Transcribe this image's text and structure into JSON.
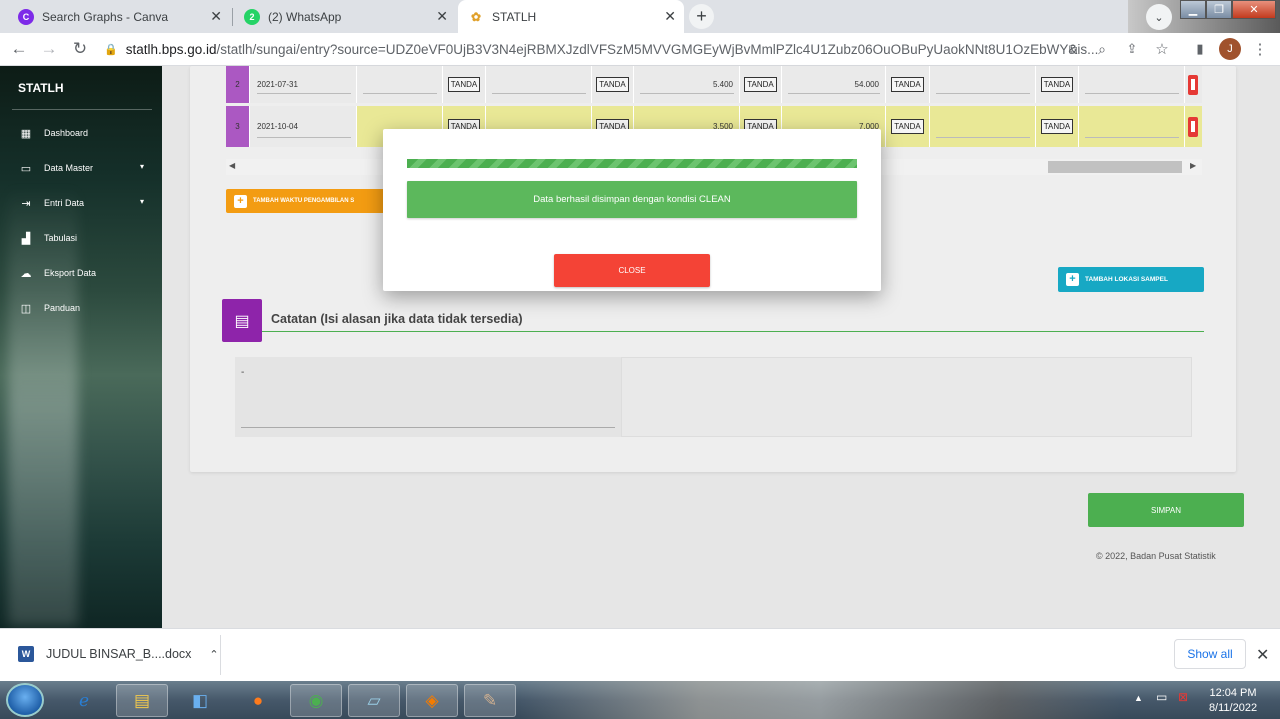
{
  "browser": {
    "tabs": [
      {
        "label": "Search Graphs - Canva",
        "icon": "canva-icon",
        "color": "#7d2ae8"
      },
      {
        "label": "(2) WhatsApp",
        "icon": "whatsapp-icon",
        "badge": "2",
        "color": "#25d366"
      },
      {
        "label": "STATLH",
        "icon": "statlh-icon",
        "active": true
      }
    ],
    "url_domain": "statlh.bps.go.id",
    "url_path": "/statlh/sungai/entry?source=UDZ0eVF0UjB3V3N4ejRBMXJzdlVFSzM5MVVGMGEyWjBvMmlPZlc4U1Zubz06OuOBuPyUaokNNt8U1OzEbWY&is...",
    "profile_initial": "J"
  },
  "sidebar": {
    "brand": "STATLH",
    "items": [
      {
        "label": "Dashboard",
        "icon": "dashboard-icon"
      },
      {
        "label": "Data Master",
        "icon": "folder-icon",
        "caret": true
      },
      {
        "label": "Entri Data",
        "icon": "login-icon",
        "caret": true
      },
      {
        "label": "Tabulasi",
        "icon": "bar-chart-icon"
      },
      {
        "label": "Eksport Data",
        "icon": "cloud-download-icon"
      },
      {
        "label": "Panduan",
        "icon": "book-icon"
      }
    ]
  },
  "table": {
    "rows": [
      {
        "no": "2",
        "date": "2021-07-31",
        "tanda": "TANDA",
        "v1": "5.400",
        "v2": "54.000",
        "highlight": false
      },
      {
        "no": "3",
        "date": "2021-10-04",
        "tanda": "TANDA",
        "v1": "3.500",
        "v2": "7.000",
        "highlight": true
      }
    ]
  },
  "buttons": {
    "add_time": "TAMBAH WAKTU PENGAMBILAN S",
    "add_location": "TAMBAH LOKASI SAMPEL",
    "save": "SIMPAN"
  },
  "notes": {
    "title": "Catatan (Isi alasan jika data tidak tersedia)",
    "value": "-"
  },
  "footer": {
    "copyright": "© 2022, Badan Pusat Statistik"
  },
  "modal": {
    "message": "Data berhasil disimpan dengan kondisi CLEAN",
    "close_label": "CLOSE",
    "progress": 1.0
  },
  "download_bar": {
    "file_name": "JUDUL BINSAR_B....docx",
    "show_all": "Show all"
  },
  "taskbar": {
    "time": "12:04 PM",
    "date": "8/11/2022"
  },
  "colors": {
    "accent_green": "#4caf50",
    "danger_red": "#f44336",
    "purple": "#ab58c2",
    "cyan": "#17a8c4",
    "orange": "#f39c12"
  }
}
